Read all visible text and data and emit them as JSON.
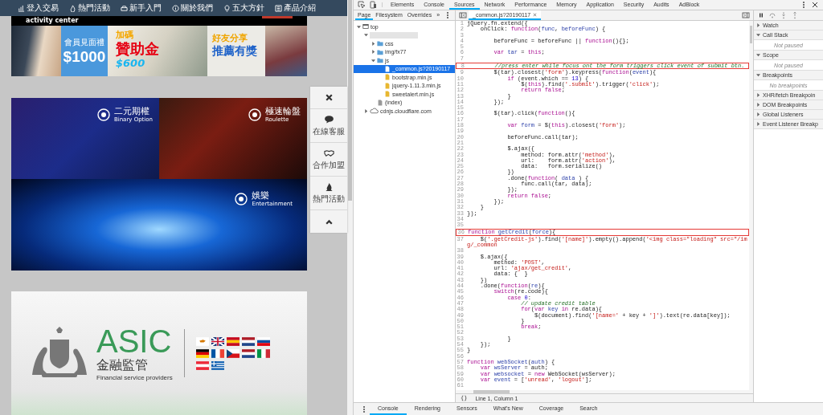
{
  "site": {
    "nav": [
      {
        "label": "登入交易"
      },
      {
        "label": "熱門活動"
      },
      {
        "label": "新手入門"
      },
      {
        "label": "關於我們"
      },
      {
        "label": "五大方針"
      },
      {
        "label": "產品介紹"
      }
    ],
    "activity_bar": {
      "label": "activity center"
    },
    "banners": [
      {
        "kind": "photo"
      },
      {
        "kind": "offer",
        "caption": "會員見面禮",
        "amount": "$1000"
      },
      {
        "kind": "bonus",
        "headline": "加碼",
        "title": "贊助金",
        "amount": "$600"
      },
      {
        "kind": "referral",
        "headline": "好友分享",
        "title": "推薦有獎"
      }
    ],
    "games": [
      {
        "kind": "chart",
        "title": "二元期權",
        "subtitle": "Binary Option"
      },
      {
        "kind": "roulette",
        "title": "極速輪盤",
        "subtitle": "Roulette"
      },
      {
        "kind": "wide",
        "title": "娛樂",
        "subtitle": "Entertainment"
      }
    ],
    "float_menu": [
      {
        "kind": "close"
      },
      {
        "kind": "chat",
        "label": "在線客服"
      },
      {
        "kind": "partner",
        "label": "合作加盟"
      },
      {
        "kind": "hot",
        "label": "熱門活動"
      },
      {
        "kind": "top"
      }
    ],
    "regulator": {
      "name": "ASIC",
      "title": "金融監管",
      "subtitle": "Financial service providers"
    }
  },
  "devtools": {
    "tabs": [
      {
        "label": "Elements",
        "selected": false
      },
      {
        "label": "Console",
        "selected": false
      },
      {
        "label": "Sources",
        "selected": true
      },
      {
        "label": "Network",
        "selected": false
      },
      {
        "label": "Performance",
        "selected": false
      },
      {
        "label": "Memory",
        "selected": false
      },
      {
        "label": "Application",
        "selected": false
      },
      {
        "label": "Security",
        "selected": false
      },
      {
        "label": "Audits",
        "selected": false
      },
      {
        "label": "AdBlock",
        "selected": false
      }
    ],
    "navigator": {
      "tabs": [
        {
          "label": "Page",
          "selected": true
        },
        {
          "label": "Filesystem",
          "selected": false
        },
        {
          "label": "Overrides",
          "selected": false
        }
      ],
      "more": "»",
      "tree": [
        {
          "label": "top",
          "kind": "frame",
          "expanded": true,
          "selected": false,
          "children": [
            {
              "kind": "domain",
              "expanded": true,
              "selected": false,
              "children": [
                {
                  "label": "css",
                  "kind": "folder",
                  "expanded": false,
                  "selected": false
                },
                {
                  "label": "img/fx77",
                  "kind": "folder",
                  "expanded": false,
                  "selected": false
                },
                {
                  "label": "js",
                  "kind": "folder",
                  "expanded": true,
                  "selected": false,
                  "children": [
                    {
                      "label": "_common.js?20190117",
                      "kind": "script",
                      "selected": true
                    },
                    {
                      "label": "bootstrap.min.js",
                      "kind": "script",
                      "selected": false
                    },
                    {
                      "label": "jquery-1.11.3.min.js",
                      "kind": "script",
                      "selected": false
                    },
                    {
                      "label": "sweetalert.min.js",
                      "kind": "script",
                      "selected": false
                    }
                  ]
                },
                {
                  "label": "(index)",
                  "kind": "document",
                  "selected": false
                }
              ]
            },
            {
              "label": "cdnjs.cloudflare.com",
              "kind": "cloud",
              "expanded": false,
              "selected": false
            }
          ]
        }
      ]
    },
    "editor": {
      "tab": "_common.js?20190117",
      "lines": [
        {
          "n": "1",
          "highlighted": false,
          "parts": [
            {
              "text": "jQuery.fn.extend({",
              "kind": "plain"
            }
          ]
        },
        {
          "n": "2",
          "highlighted": false,
          "parts": [
            {
              "text": "    onClick: ",
              "kind": "plain"
            },
            {
              "text": "function",
              "kind": "keyword"
            },
            {
              "text": "(",
              "kind": "plain"
            },
            {
              "text": "func",
              "kind": "name"
            },
            {
              "text": ", ",
              "kind": "plain"
            },
            {
              "text": "beforeFunc",
              "kind": "name"
            },
            {
              "text": ") {",
              "kind": "plain"
            }
          ]
        },
        {
          "n": "3",
          "highlighted": false
        },
        {
          "n": "4",
          "highlighted": false,
          "parts": [
            {
              "text": "        beforeFunc = beforeFunc || ",
              "kind": "plain"
            },
            {
              "text": "function",
              "kind": "keyword"
            },
            {
              "text": "(){};",
              "kind": "plain"
            }
          ]
        },
        {
          "n": "5",
          "highlighted": false
        },
        {
          "n": "6",
          "highlighted": false,
          "parts": [
            {
              "text": "        var ",
              "kind": "keyword"
            },
            {
              "text": "tar",
              "kind": "name"
            },
            {
              "text": " = ",
              "kind": "plain"
            },
            {
              "text": "this",
              "kind": "keyword"
            },
            {
              "text": ";",
              "kind": "plain"
            }
          ]
        },
        {
          "n": "7",
          "highlighted": false
        },
        {
          "n": "8",
          "highlighted": true,
          "parts": [
            {
              "text": "        //press enter while focus ont the form triggers click event of submit btn.",
              "kind": "comment"
            }
          ]
        },
        {
          "n": "9",
          "highlighted": false,
          "parts": [
            {
              "text": "        $(tar).closest(",
              "kind": "plain"
            },
            {
              "text": "'form'",
              "kind": "string"
            },
            {
              "text": ").keypress(",
              "kind": "plain"
            },
            {
              "text": "function",
              "kind": "keyword"
            },
            {
              "text": "(",
              "kind": "plain"
            },
            {
              "text": "event",
              "kind": "name"
            },
            {
              "text": "){",
              "kind": "plain"
            }
          ]
        },
        {
          "n": "10",
          "highlighted": false,
          "parts": [
            {
              "text": "            if",
              "kind": "keyword"
            },
            {
              "text": " (event.which == ",
              "kind": "plain"
            },
            {
              "text": "13",
              "kind": "number"
            },
            {
              "text": ") {",
              "kind": "plain"
            }
          ]
        },
        {
          "n": "11",
          "highlighted": false,
          "parts": [
            {
              "text": "                $(",
              "kind": "plain"
            },
            {
              "text": "this",
              "kind": "keyword"
            },
            {
              "text": ").find(",
              "kind": "plain"
            },
            {
              "text": "'.submit'",
              "kind": "string"
            },
            {
              "text": ").trigger(",
              "kind": "plain"
            },
            {
              "text": "'click'",
              "kind": "string"
            },
            {
              "text": ");",
              "kind": "plain"
            }
          ]
        },
        {
          "n": "12",
          "highlighted": false,
          "parts": [
            {
              "text": "                return ",
              "kind": "keyword"
            },
            {
              "text": "false",
              "kind": "keyword"
            },
            {
              "text": ";",
              "kind": "plain"
            }
          ]
        },
        {
          "n": "13",
          "highlighted": false,
          "parts": [
            {
              "text": "            }",
              "kind": "plain"
            }
          ]
        },
        {
          "n": "14",
          "highlighted": false,
          "parts": [
            {
              "text": "        });",
              "kind": "plain"
            }
          ]
        },
        {
          "n": "15",
          "highlighted": false
        },
        {
          "n": "16",
          "highlighted": false,
          "parts": [
            {
              "text": "        $(tar).click(",
              "kind": "plain"
            },
            {
              "text": "function",
              "kind": "keyword"
            },
            {
              "text": "(){",
              "kind": "plain"
            }
          ]
        },
        {
          "n": "17",
          "highlighted": false
        },
        {
          "n": "18",
          "highlighted": false,
          "parts": [
            {
              "text": "            var ",
              "kind": "keyword"
            },
            {
              "text": "form",
              "kind": "name"
            },
            {
              "text": " = $(",
              "kind": "plain"
            },
            {
              "text": "this",
              "kind": "keyword"
            },
            {
              "text": ").closest(",
              "kind": "plain"
            },
            {
              "text": "'form'",
              "kind": "string"
            },
            {
              "text": ");",
              "kind": "plain"
            }
          ]
        },
        {
          "n": "19",
          "highlighted": false
        },
        {
          "n": "20",
          "highlighted": false,
          "parts": [
            {
              "text": "            beforeFunc.call(tar);",
              "kind": "plain"
            }
          ]
        },
        {
          "n": "21",
          "highlighted": false
        },
        {
          "n": "22",
          "highlighted": false,
          "parts": [
            {
              "text": "            $.ajax({",
              "kind": "plain"
            }
          ]
        },
        {
          "n": "23",
          "highlighted": false,
          "parts": [
            {
              "text": "                method: form.attr(",
              "kind": "plain"
            },
            {
              "text": "'method'",
              "kind": "string"
            },
            {
              "text": "),",
              "kind": "plain"
            }
          ]
        },
        {
          "n": "24",
          "highlighted": false,
          "parts": [
            {
              "text": "                url:    form.attr(",
              "kind": "plain"
            },
            {
              "text": "'action'",
              "kind": "string"
            },
            {
              "text": "),",
              "kind": "plain"
            }
          ]
        },
        {
          "n": "25",
          "highlighted": false,
          "parts": [
            {
              "text": "                data:   form.serialize()",
              "kind": "plain"
            }
          ]
        },
        {
          "n": "26",
          "highlighted": false,
          "parts": [
            {
              "text": "            })",
              "kind": "plain"
            }
          ]
        },
        {
          "n": "27",
          "highlighted": false,
          "parts": [
            {
              "text": "            .done(",
              "kind": "plain"
            },
            {
              "text": "function",
              "kind": "keyword"
            },
            {
              "text": "( ",
              "kind": "plain"
            },
            {
              "text": "data",
              "kind": "name"
            },
            {
              "text": " ) {",
              "kind": "plain"
            }
          ]
        },
        {
          "n": "28",
          "highlighted": false,
          "parts": [
            {
              "text": "                func.call(tar, data);",
              "kind": "plain"
            }
          ]
        },
        {
          "n": "29",
          "highlighted": false,
          "parts": [
            {
              "text": "            });",
              "kind": "plain"
            }
          ]
        },
        {
          "n": "30",
          "highlighted": false,
          "parts": [
            {
              "text": "            return ",
              "kind": "keyword"
            },
            {
              "text": "false",
              "kind": "keyword"
            },
            {
              "text": ";",
              "kind": "plain"
            }
          ]
        },
        {
          "n": "31",
          "highlighted": false,
          "parts": [
            {
              "text": "        });",
              "kind": "plain"
            }
          ]
        },
        {
          "n": "32",
          "highlighted": false,
          "parts": [
            {
              "text": "    }",
              "kind": "plain"
            }
          ]
        },
        {
          "n": "33",
          "highlighted": false,
          "parts": [
            {
              "text": "});",
              "kind": "plain"
            }
          ]
        },
        {
          "n": "34",
          "highlighted": false
        },
        {
          "n": "35",
          "highlighted": false
        },
        {
          "n": "36",
          "highlighted": true,
          "parts": [
            {
              "text": "function ",
              "kind": "keyword"
            },
            {
              "text": "getCredit",
              "kind": "name"
            },
            {
              "text": "(",
              "kind": "plain"
            },
            {
              "text": "force",
              "kind": "name"
            },
            {
              "text": "){",
              "kind": "plain"
            }
          ]
        },
        {
          "n": "37",
          "highlighted": false,
          "parts": [
            {
              "text": "    $(",
              "kind": "plain"
            },
            {
              "text": "'.getCredit-js'",
              "kind": "string"
            },
            {
              "text": ").find(",
              "kind": "plain"
            },
            {
              "text": "'[name]'",
              "kind": "string"
            },
            {
              "text": ").empty().append(",
              "kind": "plain"
            },
            {
              "text": "'<img class=\"loading\" src=\"/img/_common",
              "kind": "string"
            }
          ]
        },
        {
          "n": "38",
          "highlighted": false
        },
        {
          "n": "39",
          "highlighted": false,
          "parts": [
            {
              "text": "    $.ajax({",
              "kind": "plain"
            }
          ]
        },
        {
          "n": "40",
          "highlighted": false,
          "parts": [
            {
              "text": "        method: ",
              "kind": "plain"
            },
            {
              "text": "'POST'",
              "kind": "string"
            },
            {
              "text": ",",
              "kind": "plain"
            }
          ]
        },
        {
          "n": "41",
          "highlighted": false,
          "parts": [
            {
              "text": "        url: ",
              "kind": "plain"
            },
            {
              "text": "'ajax/get_credit'",
              "kind": "string"
            },
            {
              "text": ",",
              "kind": "plain"
            }
          ]
        },
        {
          "n": "42",
          "highlighted": false,
          "parts": [
            {
              "text": "        data: {  }",
              "kind": "plain"
            }
          ]
        },
        {
          "n": "43",
          "highlighted": false,
          "parts": [
            {
              "text": "    })",
              "kind": "plain"
            }
          ]
        },
        {
          "n": "44",
          "highlighted": false,
          "parts": [
            {
              "text": "    .done(",
              "kind": "plain"
            },
            {
              "text": "function",
              "kind": "keyword"
            },
            {
              "text": "(",
              "kind": "plain"
            },
            {
              "text": "re",
              "kind": "name"
            },
            {
              "text": "){",
              "kind": "plain"
            }
          ]
        },
        {
          "n": "45",
          "highlighted": false,
          "parts": [
            {
              "text": "        switch",
              "kind": "keyword"
            },
            {
              "text": "(re.code){",
              "kind": "plain"
            }
          ]
        },
        {
          "n": "46",
          "highlighted": false,
          "parts": [
            {
              "text": "            case ",
              "kind": "keyword"
            },
            {
              "text": "0",
              "kind": "number"
            },
            {
              "text": ":",
              "kind": "plain"
            }
          ]
        },
        {
          "n": "47",
          "highlighted": false,
          "parts": [
            {
              "text": "                // update credit table",
              "kind": "comment"
            }
          ]
        },
        {
          "n": "48",
          "highlighted": false,
          "parts": [
            {
              "text": "                for",
              "kind": "keyword"
            },
            {
              "text": "(",
              "kind": "plain"
            },
            {
              "text": "var ",
              "kind": "keyword"
            },
            {
              "text": "key",
              "kind": "name"
            },
            {
              "text": " in",
              "kind": "keyword"
            },
            {
              "text": " re.data){",
              "kind": "plain"
            }
          ]
        },
        {
          "n": "49",
          "highlighted": false,
          "parts": [
            {
              "text": "                    $(document).find(",
              "kind": "plain"
            },
            {
              "text": "'[name='",
              "kind": "string"
            },
            {
              "text": " + key + ",
              "kind": "plain"
            },
            {
              "text": "']'",
              "kind": "string"
            },
            {
              "text": ").text(re.data[key]);",
              "kind": "plain"
            }
          ]
        },
        {
          "n": "50",
          "highlighted": false,
          "parts": [
            {
              "text": "                }",
              "kind": "plain"
            }
          ]
        },
        {
          "n": "51",
          "highlighted": false,
          "parts": [
            {
              "text": "                break",
              "kind": "keyword"
            },
            {
              "text": ";",
              "kind": "plain"
            }
          ]
        },
        {
          "n": "52",
          "highlighted": false
        },
        {
          "n": "53",
          "highlighted": false,
          "parts": [
            {
              "text": "            }",
              "kind": "plain"
            }
          ]
        },
        {
          "n": "54",
          "highlighted": false,
          "parts": [
            {
              "text": "    });",
              "kind": "plain"
            }
          ]
        },
        {
          "n": "55",
          "highlighted": false,
          "parts": [
            {
              "text": "}",
              "kind": "plain"
            }
          ]
        },
        {
          "n": "56",
          "highlighted": false
        },
        {
          "n": "57",
          "highlighted": false,
          "parts": [
            {
              "text": "function ",
              "kind": "keyword"
            },
            {
              "text": "webSocket",
              "kind": "name"
            },
            {
              "text": "(",
              "kind": "plain"
            },
            {
              "text": "auth",
              "kind": "name"
            },
            {
              "text": ") {",
              "kind": "plain"
            }
          ]
        },
        {
          "n": "58",
          "highlighted": false,
          "parts": [
            {
              "text": "    var ",
              "kind": "keyword"
            },
            {
              "text": "wsServer",
              "kind": "name"
            },
            {
              "text": " = auth;",
              "kind": "plain"
            }
          ]
        },
        {
          "n": "59",
          "highlighted": false,
          "parts": [
            {
              "text": "    var ",
              "kind": "keyword"
            },
            {
              "text": "websocket",
              "kind": "name"
            },
            {
              "text": " = ",
              "kind": "plain"
            },
            {
              "text": "new",
              "kind": "keyword"
            },
            {
              "text": " WebSocket(wsServer);",
              "kind": "plain"
            }
          ]
        },
        {
          "n": "60",
          "highlighted": false,
          "parts": [
            {
              "text": "    var ",
              "kind": "keyword"
            },
            {
              "text": "event",
              "kind": "name"
            },
            {
              "text": " = [",
              "kind": "plain"
            },
            {
              "text": "'unread'",
              "kind": "string"
            },
            {
              "text": ", ",
              "kind": "plain"
            },
            {
              "text": "'logout'",
              "kind": "string"
            },
            {
              "text": "];",
              "kind": "plain"
            }
          ]
        },
        {
          "n": "61",
          "highlighted": false
        }
      ],
      "format_label": "{}",
      "status": "Line 1, Column 1"
    },
    "debugger": {
      "sections": [
        {
          "title": "Watch",
          "expanded": false
        },
        {
          "title": "Call Stack",
          "expanded": true,
          "note": "Not paused"
        },
        {
          "title": "Scope",
          "expanded": true,
          "note": "Not paused"
        },
        {
          "title": "Breakpoints",
          "expanded": true,
          "note": "No breakpoints"
        },
        {
          "title": "XHR/fetch Breakpoin",
          "expanded": false
        },
        {
          "title": "DOM Breakpoints",
          "expanded": false
        },
        {
          "title": "Global Listeners",
          "expanded": false
        },
        {
          "title": "Event Listener Breakp",
          "expanded": false
        }
      ]
    },
    "drawer_tabs": [
      {
        "label": "Console",
        "selected": true
      },
      {
        "label": "Rendering",
        "selected": false
      },
      {
        "label": "Sensors",
        "selected": false
      },
      {
        "label": "What's New",
        "selected": false
      },
      {
        "label": "Coverage",
        "selected": false
      },
      {
        "label": "Search",
        "selected": false
      }
    ]
  }
}
